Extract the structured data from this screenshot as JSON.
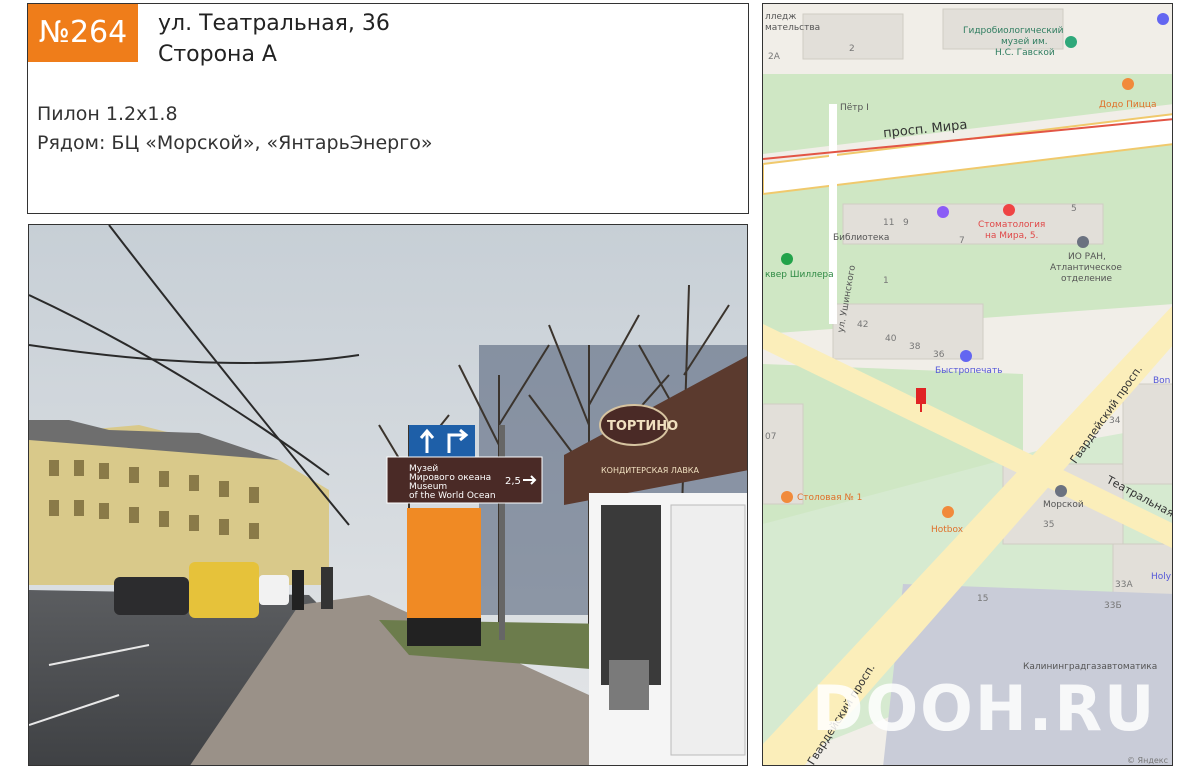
{
  "header": {
    "number": "№264",
    "address": "ул. Театральная, 36",
    "side": "Сторона А",
    "format": "Пилон 1.2x1.8",
    "nearby": "Рядом: БЦ «Морской», «ЯнтарьЭнерго»"
  },
  "photo": {
    "sign_museum_ru_1": "Музей",
    "sign_museum_ru_2": "Мирового океана",
    "sign_museum_en_1": "Museum",
    "sign_museum_en_2": "of the World Ocean",
    "sign_distance": "2,5",
    "shop_name": "ТОРТИНО",
    "shop_subtitle": "КОНДИТЕРСКАЯ ЛАВКА"
  },
  "map": {
    "labels": {
      "top_left_1": "лледж",
      "top_left_2": "мательства",
      "bld_2": "2",
      "bld_2a": "2А",
      "museum_1": "Гидробиологический",
      "museum_2": "музей им.",
      "museum_3": "Н.С. Гавской",
      "petr": "Пётр I",
      "dodo": "Додо Пицца",
      "prosp_mira": "просп. Мира",
      "bld_11": "11",
      "bld_9": "9",
      "bld_5": "5",
      "bld_7": "7",
      "stomatology_1": "Стоматология",
      "stomatology_2": "на Мира, 5.",
      "library": "Библиотека",
      "io_ran_1": "ИО РАН,",
      "io_ran_2": "Атлантическое",
      "io_ran_3": "отделение",
      "schiller": "квер Шиллера",
      "ul_ushinskogo": "ул. Ушинского",
      "bld_1": "1",
      "bld_42": "42",
      "bld_40": "40",
      "bld_38": "38",
      "bld_36": "36",
      "bystropechat": "Быстропечать",
      "bon": "Bon",
      "gvard_prosp": "Гвардейский просп.",
      "bld_34": "34",
      "teatralnaya": "Театральная",
      "bld_07": "07",
      "stolovaya": "Столовая № 1",
      "morskoy": "Морской",
      "bld_35": "35",
      "hotbox": "Hotbox",
      "holy": "Holy",
      "bld_33a": "33А",
      "bld_33b": "33Б",
      "bld_15": "15",
      "kaliningrad": "Калининградгазавтоматика",
      "gvard_prosp_2": "Гвардейский просп.",
      "yandex": "© Яндекс"
    },
    "watermark": "DOOH.RU"
  }
}
